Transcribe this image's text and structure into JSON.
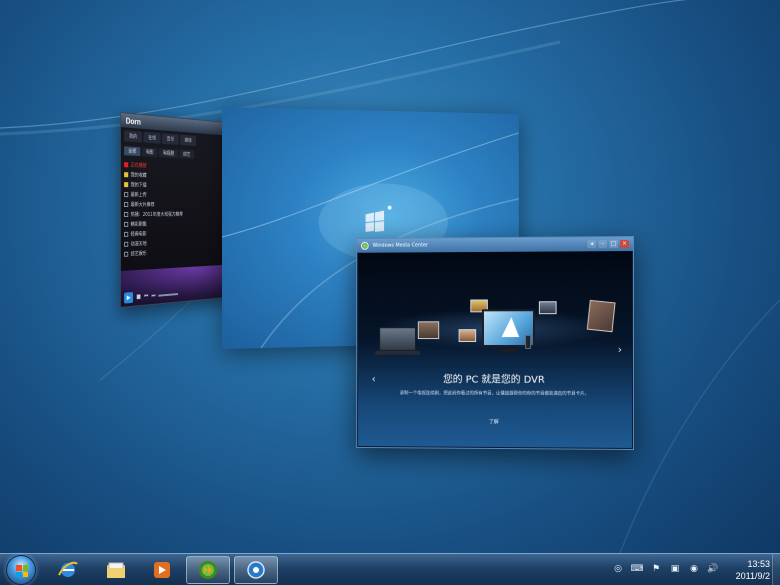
{
  "player_window": {
    "logo": "Dorn",
    "tabs": [
      "我的",
      "在线",
      "音乐",
      "媒体"
    ],
    "subtabs": [
      "全部",
      "电影",
      "电视剧",
      "综艺"
    ],
    "list": [
      {
        "text": "正在播放",
        "style": "red"
      },
      {
        "text": "我的收藏",
        "style": "folder"
      },
      {
        "text": "我的下载",
        "style": "folder"
      },
      {
        "text": "最新上传",
        "style": "normal"
      },
      {
        "text": "最新大片推荐",
        "style": "normal"
      },
      {
        "text": "热播：2011年度大戏强力推荐",
        "style": "normal"
      },
      {
        "text": "精彩剧集",
        "style": "normal"
      },
      {
        "text": "经典电影",
        "style": "normal"
      },
      {
        "text": "动漫天地",
        "style": "normal"
      },
      {
        "text": "综艺娱乐",
        "style": "normal"
      }
    ],
    "controls": {
      "play": "▶",
      "stop": "■",
      "prev": "⏮",
      "next": "⏭"
    }
  },
  "wmc_window": {
    "title": "Windows Media Center",
    "buttons": {
      "back": "◂",
      "minimize": "–",
      "maximize": "□",
      "close": "×"
    },
    "headline": "您的 PC 就是您的 DVR",
    "description": "录制一个电视连续剧，把此前你看过的所有节目，让播放器帮你的你的节目都装满您的节目卡片。",
    "link": "了解",
    "nav_left": "‹",
    "nav_right": "›"
  },
  "taskbar": {
    "pinned": [
      "start-button",
      "internet-explorer",
      "windows-explorer",
      "windows-media-player",
      "windows-media-center",
      "flip-3d-app"
    ],
    "tray": {
      "icons": [
        "◎",
        "⌨",
        "⚑",
        "▣",
        "◉",
        "🔊"
      ]
    },
    "clock": {
      "time": "13:53",
      "date": "2011/9/2"
    }
  },
  "colors": {
    "desktop_center": "#3d8fc4",
    "desktop_edge": "#0e3560",
    "taskbar_top": "#3e6690",
    "taskbar_bottom": "#12304f",
    "player_red": "#ff3b30",
    "wmc_accent": "#5a88b8"
  }
}
